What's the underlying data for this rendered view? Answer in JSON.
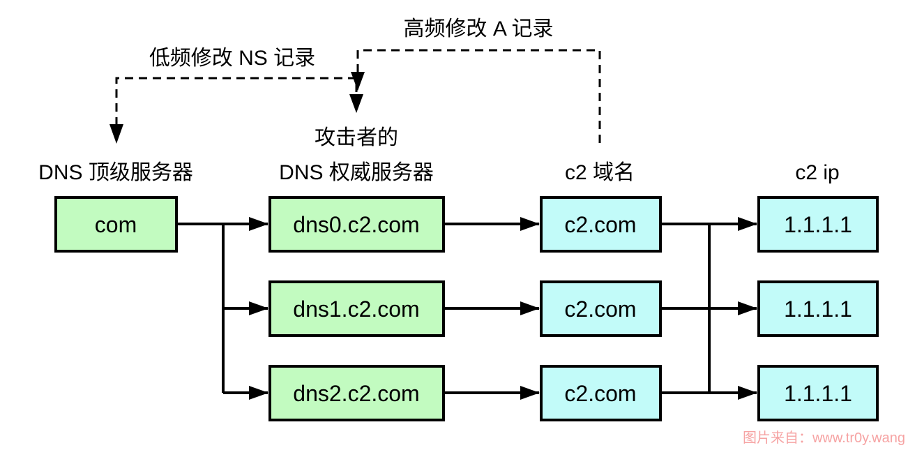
{
  "colors": {
    "green": "#c2fbc0",
    "cyan": "#c2fbf9",
    "stroke": "#000000",
    "watermark": "#f6a3a3"
  },
  "columns": {
    "tld": {
      "label": "DNS 顶级服务器"
    },
    "auth": {
      "label_top": "攻击者的",
      "label": "DNS 权威服务器"
    },
    "domain": {
      "label": "c2 域名"
    },
    "ip": {
      "label": "c2 ip"
    }
  },
  "nodes": {
    "tld": "com",
    "auth": [
      "dns0.c2.com",
      "dns1.c2.com",
      "dns2.c2.com"
    ],
    "domain": [
      "c2.com",
      "c2.com",
      "c2.com"
    ],
    "ip": [
      "1.1.1.1",
      "1.1.1.1",
      "1.1.1.1"
    ]
  },
  "annotations": {
    "ns": "低频修改 NS 记录",
    "a": "高频修改 A 记录"
  },
  "watermark": "图片来自：www.tr0y.wang"
}
